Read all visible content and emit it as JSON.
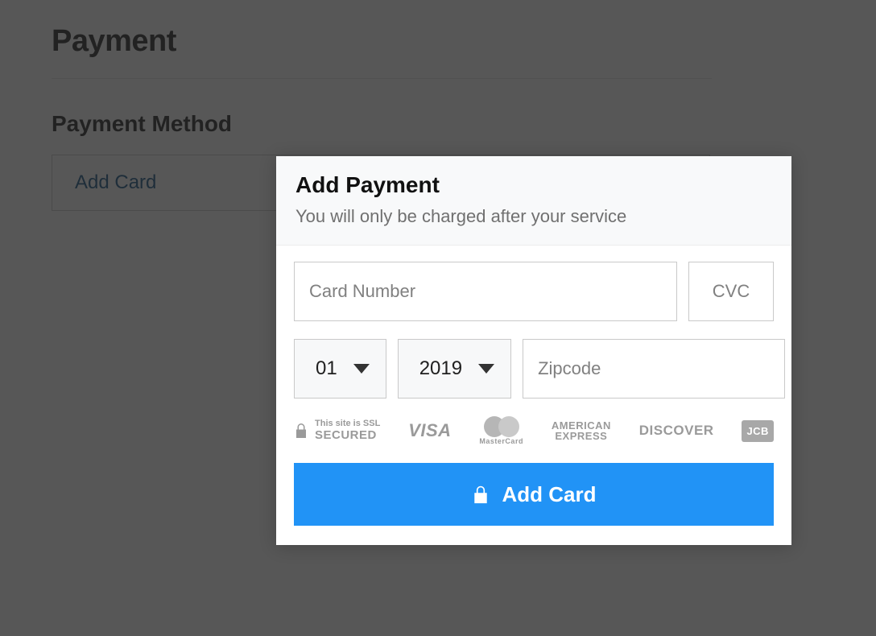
{
  "page": {
    "title": "Payment",
    "section_title": "Payment Method",
    "add_card_button": "Add Card"
  },
  "modal": {
    "title": "Add Payment",
    "subtitle": "You will only be charged after your service",
    "card_number_placeholder": "Card Number",
    "cvc_placeholder": "CVC",
    "month_value": "01",
    "year_value": "2019",
    "zipcode_placeholder": "Zipcode",
    "ssl_small": "This site is SSL",
    "ssl_big": "SECURED",
    "brand_visa": "VISA",
    "brand_mastercard": "MasterCard",
    "brand_amex_line1": "AMERICAN",
    "brand_amex_line2": "EXPRESS",
    "brand_discover": "DISCOVER",
    "brand_jcb": "JCB",
    "submit_label": "Add Card"
  },
  "colors": {
    "primary_button": "#2193f6",
    "link": "#00457c",
    "muted": "#9a9a9a"
  }
}
